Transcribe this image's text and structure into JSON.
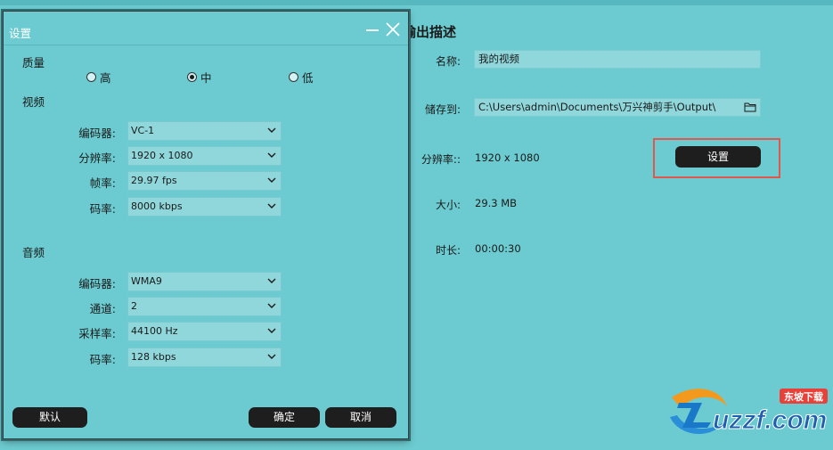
{
  "output": {
    "title": "输出描述",
    "name_label": "名称:",
    "name_value": "我的视频",
    "save_label": "储存到:",
    "save_path": "C:\\Users\\admin\\Documents\\万兴神剪手\\Output\\",
    "resolution_label": "分辨率::",
    "resolution_value": "1920 x 1080",
    "settings_button": "设置",
    "size_label": "大小:",
    "size_value": "29.3 MB",
    "duration_label": "时长:",
    "duration_value": "00:00:30"
  },
  "dialog": {
    "title": "设置",
    "quality_label": "质量",
    "quality_options": [
      "高",
      "中",
      "低"
    ],
    "quality_selected": "中",
    "video_label": "视频",
    "video": {
      "encoder_label": "编码器:",
      "encoder_value": "VC-1",
      "resolution_label": "分辨率:",
      "resolution_value": "1920 x 1080",
      "framerate_label": "帧率:",
      "framerate_value": "29.97 fps",
      "bitrate_label": "码率:",
      "bitrate_value": "8000 kbps"
    },
    "audio_label": "音频",
    "audio": {
      "encoder_label": "编码器:",
      "encoder_value": "WMA9",
      "channels_label": "通道:",
      "channels_value": "2",
      "samplerate_label": "采样率:",
      "samplerate_value": "44100 Hz",
      "bitrate_label": "码率:",
      "bitrate_value": "128 kbps"
    },
    "default_button": "默认",
    "ok_button": "确定",
    "cancel_button": "取消"
  },
  "watermark": {
    "site": "uzzf.com",
    "badge": "东坡下载"
  },
  "colors": {
    "background": "#6ccbd0",
    "button_dark": "#1e1e1e",
    "highlight": "#e0574d",
    "field": "#8fd7db"
  }
}
